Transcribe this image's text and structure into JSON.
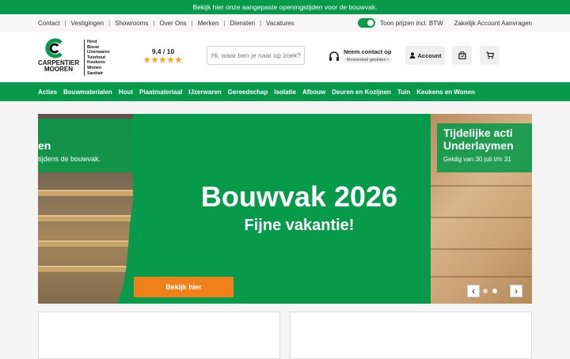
{
  "promo": {
    "text": "Bekijk hier onze aangepaste openingstijden voor de bouwvak."
  },
  "topnav": {
    "links": [
      "Contact",
      "Vestigingen",
      "Showrooms",
      "Over Ons",
      "Merken",
      "Diensten",
      "Vacatures"
    ],
    "vat_toggle_label": "Toon prijzen incl. BTW",
    "business_link": "Zakelijk Account Aanvragen"
  },
  "header": {
    "logo": {
      "name_line1": "CARPENTIER",
      "name_line2": "MOOREN",
      "categories": [
        "Hout",
        "Bouw",
        "IJzerwaren",
        "Tuinhout",
        "Keukens",
        "Wonen",
        "Sanitair"
      ]
    },
    "rating": {
      "score": "9,4 / 10",
      "stars": "★★★★★"
    },
    "search": {
      "placeholder": "Hi, waar ben je naar op zoek?"
    },
    "contact": {
      "title": "Neem contact op",
      "status": "Momenteel gesloten"
    },
    "account_label": "Account",
    "icons": {
      "contact": "headset-icon",
      "account": "user-icon",
      "orders": "bag-icon",
      "cart": "cart-icon"
    }
  },
  "mainnav": {
    "items": [
      "Acties",
      "Bouwmaterialen",
      "Hout",
      "Plaatmateriaal",
      "IJzerwaren",
      "Gereedschap",
      "Isolatie",
      "Afbouw",
      "Deuren en Kozijnen",
      "Tuin",
      "Keukens en Wonen"
    ]
  },
  "hero": {
    "left_caption": {
      "title": "en",
      "subtitle": "tijdens de bouwvak."
    },
    "title": "Bouwvak 2026",
    "subtitle": "Fijne vakantie!",
    "cta_label": "Bekijk hier",
    "right_caption": {
      "title_line1": "Tijdelijke acti",
      "title_line2": "Underlaymen",
      "subtitle": "Geldig van 30 juli t/m 31"
    },
    "prev_arrow": "‹",
    "next_arrow": "›",
    "active_slide": 2
  },
  "colors": {
    "brand_green": "#079a4a",
    "cta_orange": "#f0811a",
    "star": "#f7a21b"
  }
}
